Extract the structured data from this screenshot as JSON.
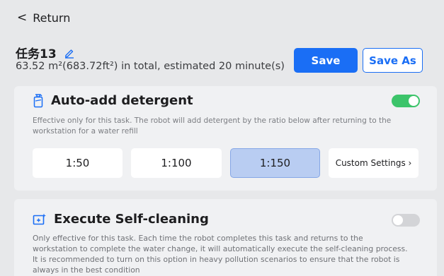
{
  "nav": {
    "back_label": "Return",
    "back_chevron": "<"
  },
  "task": {
    "name": "任务13",
    "summary": "63.52 m²(683.72ft²) in total, estimated 20 minute(s)"
  },
  "actions": {
    "save_label": "Save",
    "save_as_label": "Save As"
  },
  "detergent": {
    "title": "Auto-add detergent",
    "enabled": true,
    "description": "Effective only for this task. The robot will add detergent by the ratio below after returning to the workstation for a water refill",
    "ratios": [
      "1:50",
      "1:100",
      "1:150"
    ],
    "selected_ratio": "1:150",
    "custom_label": "Custom Settings ›"
  },
  "self_cleaning": {
    "title": "Execute Self-cleaning",
    "enabled": false,
    "description": "Only effective for this task. Each time the robot completes this task and returns to the workstation to complete the water change, it will automatically execute the self-cleaning process. It is recommended to turn on this option in heavy pollution scenarios to ensure that the robot is always in the best condition"
  },
  "colors": {
    "accent": "#1a6ef5",
    "toggle_on": "#3cc46a",
    "toggle_off": "#d3d4d7",
    "selected_chip": "#b9cdf2"
  }
}
